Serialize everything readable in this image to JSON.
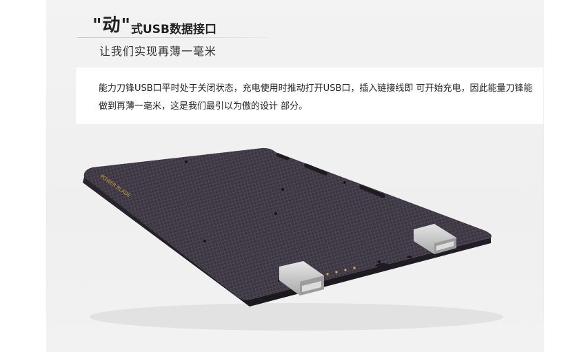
{
  "header": {
    "title_quoted": "\"动\"",
    "title_rest": "式USB数据接口",
    "subtitle": "让我们实现再薄一毫米"
  },
  "description": {
    "line1": "能力刀锋USB口平时处于关闭状态，充电使用时推动打开USB口，插入链接线即 可开始充电，因此能量刀锋能",
    "line2": "做到再薄一毫米，这是我们最引以为傲的设计 部分。"
  },
  "product": {
    "brand_mark": "POWER BLADE"
  },
  "colors": {
    "body": "#3a3540",
    "accent_text": "#c9a030",
    "clip_metal": "#c9c9c9"
  }
}
